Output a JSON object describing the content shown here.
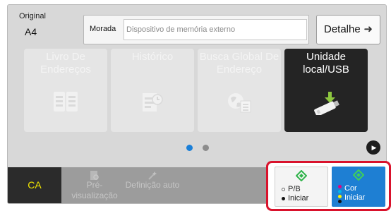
{
  "original": {
    "label": "Original",
    "value": "A4"
  },
  "address": {
    "label": "Morada",
    "placeholder": "Dispositivo de memória externo"
  },
  "detail_button": {
    "label": "Detalhe"
  },
  "tiles": [
    {
      "label": "Livro De Endereços",
      "icon": "address-book-icon",
      "enabled": false
    },
    {
      "label": "Histórico",
      "icon": "history-icon",
      "enabled": false
    },
    {
      "label": "Busca Global De Endereço",
      "icon": "global-address-search-icon",
      "enabled": false
    },
    {
      "label": "Unidade local/USB",
      "icon": "usb-drive-icon",
      "enabled": true
    }
  ],
  "pagination": {
    "current": 1,
    "total": 2
  },
  "bottom_bar": {
    "ca_label": "CA",
    "preview_label": "Pré-visualização",
    "auto_label": "Definição auto"
  },
  "start": {
    "bw": {
      "line1": "P/B",
      "line2": "Iniciar"
    },
    "color": {
      "line1": "Cor",
      "line2": "Iniciar"
    }
  },
  "colors": {
    "accent_blue": "#1e7fd3",
    "highlight_red": "#d9122c",
    "ca_text_yellow": "#f2e600",
    "start_green": "#2fb34a"
  }
}
